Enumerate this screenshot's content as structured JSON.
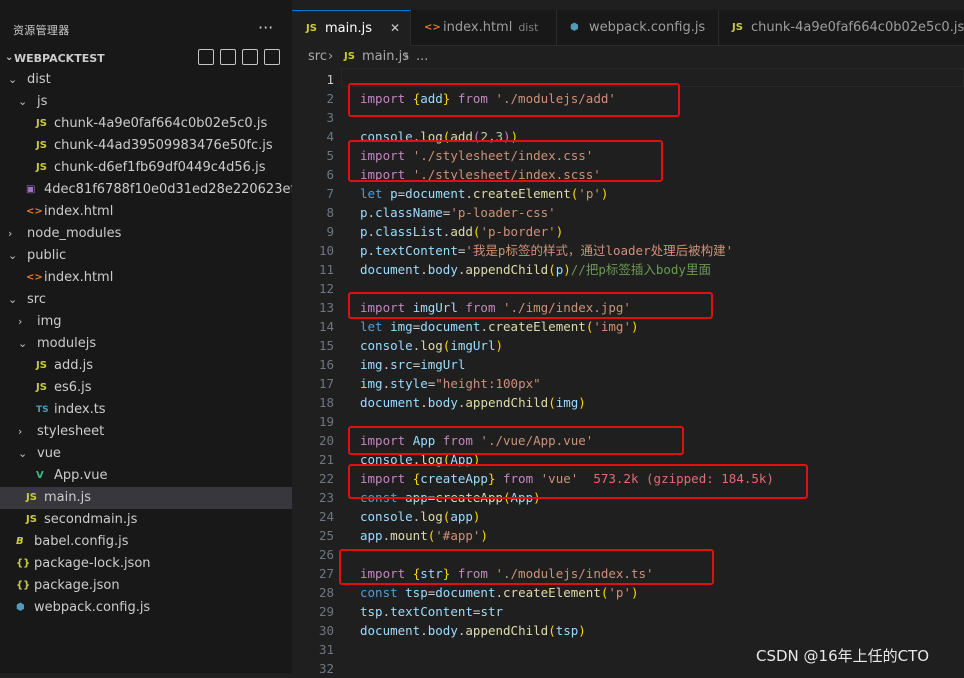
{
  "explorer": {
    "title": "资源管理器",
    "more_label": "···",
    "project_name": "WEBPACKTEST",
    "tree": [
      {
        "label": "dist",
        "type": "folder",
        "open": true,
        "depth": 0
      },
      {
        "label": "js",
        "type": "folder",
        "open": true,
        "depth": 1
      },
      {
        "label": "chunk-4a9e0faf664c0b02e5c0.js",
        "type": "js",
        "depth": 2
      },
      {
        "label": "chunk-44ad39509983476e50fc.js",
        "type": "js",
        "depth": 2
      },
      {
        "label": "chunk-d6ef1fb69df0449c4d56.js",
        "type": "js",
        "depth": 2
      },
      {
        "label": "4dec81f6788f10e0d31ed28e220623ef.jpg",
        "type": "img",
        "depth": 1
      },
      {
        "label": "index.html",
        "type": "html",
        "depth": 1
      },
      {
        "label": "node_modules",
        "type": "folder",
        "open": false,
        "depth": 0
      },
      {
        "label": "public",
        "type": "folder",
        "open": true,
        "depth": 0
      },
      {
        "label": "index.html",
        "type": "html",
        "depth": 1
      },
      {
        "label": "src",
        "type": "folder",
        "open": true,
        "depth": 0
      },
      {
        "label": "img",
        "type": "folder",
        "open": false,
        "depth": 1
      },
      {
        "label": "modulejs",
        "type": "folder",
        "open": true,
        "depth": 1
      },
      {
        "label": "add.js",
        "type": "js",
        "depth": 2
      },
      {
        "label": "es6.js",
        "type": "js",
        "depth": 2
      },
      {
        "label": "index.ts",
        "type": "ts",
        "depth": 2
      },
      {
        "label": "stylesheet",
        "type": "folder",
        "open": false,
        "depth": 1
      },
      {
        "label": "vue",
        "type": "folder",
        "open": true,
        "depth": 1
      },
      {
        "label": "App.vue",
        "type": "vue",
        "depth": 2
      },
      {
        "label": "main.js",
        "type": "js",
        "depth": 1,
        "selected": true
      },
      {
        "label": "secondmain.js",
        "type": "js",
        "depth": 1
      },
      {
        "label": "babel.config.js",
        "type": "babel",
        "depth": 0
      },
      {
        "label": "package-lock.json",
        "type": "json",
        "depth": 0
      },
      {
        "label": "package.json",
        "type": "json",
        "depth": 0
      },
      {
        "label": "webpack.config.js",
        "type": "webpack",
        "depth": 0
      }
    ]
  },
  "tabs": [
    {
      "label": "main.js",
      "icon": "js",
      "active": true,
      "close": "✕"
    },
    {
      "label": "index.html",
      "icon": "html",
      "desc": "dist"
    },
    {
      "label": "webpack.config.js",
      "icon": "webpack"
    },
    {
      "label": "chunk-4a9e0faf664c0b02e5c0.js",
      "icon": "js"
    }
  ],
  "breadcrumb": {
    "folder": "src",
    "sep": "›",
    "file": "main.js",
    "tail": "..."
  },
  "icons": {
    "js": "JS",
    "ts": "TS",
    "html": "<>",
    "json": "{}",
    "vue": "V",
    "img": "▣",
    "babel": "B",
    "webpack": "⬢"
  },
  "code_lines": [
    [],
    [
      [
        "import ",
        "kw"
      ],
      [
        "{",
        "pun"
      ],
      [
        "add",
        "var"
      ],
      [
        "}",
        "pun"
      ],
      [
        " from ",
        "kw"
      ],
      [
        "'./modulejs/add'",
        "str"
      ]
    ],
    [],
    [
      [
        "console",
        "var"
      ],
      [
        ".",
        "plain"
      ],
      [
        "log",
        "fn"
      ],
      [
        "(",
        "pun"
      ],
      [
        "add",
        "fn"
      ],
      [
        "(",
        "pun2"
      ],
      [
        "2",
        "num"
      ],
      [
        ",",
        "plain"
      ],
      [
        "3",
        "num"
      ],
      [
        ")",
        "pun2"
      ],
      [
        ")",
        "pun"
      ]
    ],
    [
      [
        "import ",
        "kw"
      ],
      [
        "'./stylesheet/index.css'",
        "str"
      ]
    ],
    [
      [
        "import ",
        "kw"
      ],
      [
        "'./stylesheet/index.scss'",
        "str"
      ]
    ],
    [
      [
        "let ",
        "kw2"
      ],
      [
        "p",
        "var"
      ],
      [
        "=",
        "plain"
      ],
      [
        "document",
        "var"
      ],
      [
        ".",
        "plain"
      ],
      [
        "createElement",
        "fn"
      ],
      [
        "(",
        "pun"
      ],
      [
        "'p'",
        "str"
      ],
      [
        ")",
        "pun"
      ]
    ],
    [
      [
        "p",
        "var"
      ],
      [
        ".",
        "plain"
      ],
      [
        "className",
        "var"
      ],
      [
        "=",
        "plain"
      ],
      [
        "'p-loader-css'",
        "str"
      ]
    ],
    [
      [
        "p",
        "var"
      ],
      [
        ".",
        "plain"
      ],
      [
        "classList",
        "var"
      ],
      [
        ".",
        "plain"
      ],
      [
        "add",
        "fn"
      ],
      [
        "(",
        "pun"
      ],
      [
        "'p-border'",
        "str"
      ],
      [
        ")",
        "pun"
      ]
    ],
    [
      [
        "p",
        "var"
      ],
      [
        ".",
        "plain"
      ],
      [
        "textContent",
        "var"
      ],
      [
        "=",
        "plain"
      ],
      [
        "'我是p标签的样式，通过loader处理后被构建'",
        "str"
      ]
    ],
    [
      [
        "document",
        "var"
      ],
      [
        ".",
        "plain"
      ],
      [
        "body",
        "var"
      ],
      [
        ".",
        "plain"
      ],
      [
        "appendChild",
        "fn"
      ],
      [
        "(",
        "pun"
      ],
      [
        "p",
        "var"
      ],
      [
        ")",
        "pun"
      ],
      [
        "//把p标签插入body里面",
        "cmt"
      ]
    ],
    [],
    [
      [
        "import ",
        "kw"
      ],
      [
        "imgUrl",
        "var"
      ],
      [
        " from ",
        "kw"
      ],
      [
        "'./img/index.jpg'",
        "str"
      ]
    ],
    [
      [
        "let ",
        "kw2"
      ],
      [
        "img",
        "var"
      ],
      [
        "=",
        "plain"
      ],
      [
        "document",
        "var"
      ],
      [
        ".",
        "plain"
      ],
      [
        "createElement",
        "fn"
      ],
      [
        "(",
        "pun"
      ],
      [
        "'img'",
        "str"
      ],
      [
        ")",
        "pun"
      ]
    ],
    [
      [
        "console",
        "var"
      ],
      [
        ".",
        "plain"
      ],
      [
        "log",
        "fn"
      ],
      [
        "(",
        "pun"
      ],
      [
        "imgUrl",
        "var"
      ],
      [
        ")",
        "pun"
      ]
    ],
    [
      [
        "img",
        "var"
      ],
      [
        ".",
        "plain"
      ],
      [
        "src",
        "var"
      ],
      [
        "=",
        "plain"
      ],
      [
        "imgUrl",
        "var"
      ]
    ],
    [
      [
        "img",
        "var"
      ],
      [
        ".",
        "plain"
      ],
      [
        "style",
        "var"
      ],
      [
        "=",
        "plain"
      ],
      [
        "\"height:100px\"",
        "str"
      ]
    ],
    [
      [
        "document",
        "var"
      ],
      [
        ".",
        "plain"
      ],
      [
        "body",
        "var"
      ],
      [
        ".",
        "plain"
      ],
      [
        "appendChild",
        "fn"
      ],
      [
        "(",
        "pun"
      ],
      [
        "img",
        "var"
      ],
      [
        ")",
        "pun"
      ]
    ],
    [],
    [
      [
        "import ",
        "kw"
      ],
      [
        "App",
        "var"
      ],
      [
        " from ",
        "kw"
      ],
      [
        "'./vue/App.vue'",
        "str"
      ]
    ],
    [
      [
        "console",
        "var"
      ],
      [
        ".",
        "plain"
      ],
      [
        "log",
        "fn"
      ],
      [
        "(",
        "pun"
      ],
      [
        "App",
        "var"
      ],
      [
        ")",
        "pun"
      ]
    ],
    [
      [
        "import ",
        "kw"
      ],
      [
        "{",
        "pun"
      ],
      [
        "createApp",
        "var"
      ],
      [
        "}",
        "pun"
      ],
      [
        " from ",
        "kw"
      ],
      [
        "'vue'",
        "str"
      ],
      [
        "  573.2k (gzipped: 184.5k)",
        "hint"
      ]
    ],
    [
      [
        "const ",
        "kw2"
      ],
      [
        "app",
        "var"
      ],
      [
        "=",
        "plain"
      ],
      [
        "createApp",
        "fn"
      ],
      [
        "(",
        "pun"
      ],
      [
        "App",
        "var"
      ],
      [
        ")",
        "pun"
      ]
    ],
    [
      [
        "console",
        "var"
      ],
      [
        ".",
        "plain"
      ],
      [
        "log",
        "fn"
      ],
      [
        "(",
        "pun"
      ],
      [
        "app",
        "var"
      ],
      [
        ")",
        "pun"
      ]
    ],
    [
      [
        "app",
        "var"
      ],
      [
        ".",
        "plain"
      ],
      [
        "mount",
        "fn"
      ],
      [
        "(",
        "pun"
      ],
      [
        "'#app'",
        "str"
      ],
      [
        ")",
        "pun"
      ]
    ],
    [],
    [
      [
        "import ",
        "kw"
      ],
      [
        "{",
        "pun"
      ],
      [
        "str",
        "var"
      ],
      [
        "}",
        "pun"
      ],
      [
        " from ",
        "kw"
      ],
      [
        "'./modulejs/index.ts'",
        "str"
      ]
    ],
    [
      [
        "const ",
        "kw2"
      ],
      [
        "tsp",
        "var"
      ],
      [
        "=",
        "plain"
      ],
      [
        "document",
        "var"
      ],
      [
        ".",
        "plain"
      ],
      [
        "createElement",
        "fn"
      ],
      [
        "(",
        "pun"
      ],
      [
        "'p'",
        "str"
      ],
      [
        ")",
        "pun"
      ]
    ],
    [
      [
        "tsp",
        "var"
      ],
      [
        ".",
        "plain"
      ],
      [
        "textContent",
        "var"
      ],
      [
        "=",
        "plain"
      ],
      [
        "str",
        "var"
      ]
    ],
    [
      [
        "document",
        "var"
      ],
      [
        ".",
        "plain"
      ],
      [
        "body",
        "var"
      ],
      [
        ".",
        "plain"
      ],
      [
        "appendChild",
        "fn"
      ],
      [
        "(",
        "pun"
      ],
      [
        "tsp",
        "var"
      ],
      [
        ")",
        "pun"
      ]
    ],
    [],
    []
  ],
  "watermark": "CSDN @16年上任的CTO"
}
